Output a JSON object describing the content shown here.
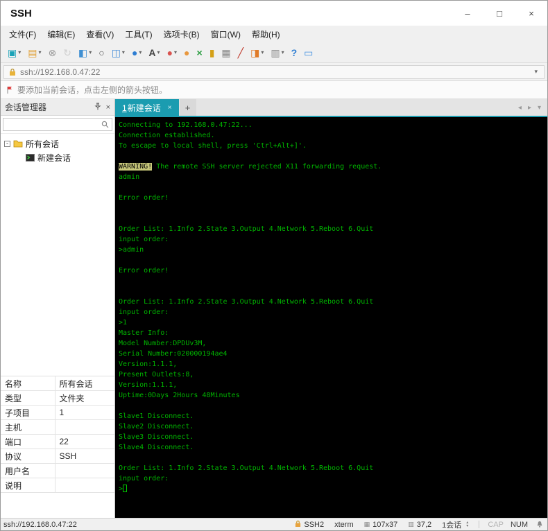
{
  "colors": {
    "accent": "#1b9cb0",
    "terminal_background": "#000000",
    "terminal_foreground": "#00b400",
    "warning_highlight": "#c8c87a"
  },
  "window": {
    "title": "SSH",
    "controls": [
      {
        "name": "minimize-button",
        "glyph": "–"
      },
      {
        "name": "maximize-button",
        "glyph": "□"
      },
      {
        "name": "close-button",
        "glyph": "×"
      }
    ]
  },
  "menu_bar": {
    "items": [
      "文件(F)",
      "编辑(E)",
      "查看(V)",
      "工具(T)",
      "选项卡(B)",
      "窗口(W)",
      "帮助(H)"
    ]
  },
  "toolbar": {
    "icons": [
      {
        "name": "new-session-icon",
        "glyph": "▣",
        "color": "#19a3b8",
        "dropdown": true
      },
      {
        "name": "open-session-icon",
        "glyph": "▤",
        "color": "#e2a33d",
        "dropdown": true
      },
      {
        "name": "disconnect-icon",
        "glyph": "⊗",
        "color": "#999999",
        "dropdown": false
      },
      {
        "name": "reconnect-icon",
        "glyph": "↻",
        "color": "#b5b5b5",
        "dropdown": false,
        "disabled": true
      },
      {
        "name": "session-manager-icon",
        "glyph": "◧",
        "color": "#3f8fd2",
        "dropdown": true
      },
      {
        "name": "find-icon",
        "glyph": "○",
        "color": "#555555",
        "dropdown": false
      },
      {
        "name": "duplicate-session-icon",
        "glyph": "◫",
        "color": "#4a90d9",
        "dropdown": true
      },
      {
        "name": "web-browser-icon",
        "glyph": "●",
        "color": "#2d7dd2",
        "dropdown": true
      },
      {
        "name": "font-icon",
        "glyph": "A",
        "color": "#444444",
        "dropdown": true,
        "bold": true
      },
      {
        "name": "logging-icon",
        "glyph": "●",
        "color": "#d9534f",
        "dropdown": true
      },
      {
        "name": "capture-icon",
        "glyph": "●",
        "color": "#e8973d",
        "dropdown": false
      },
      {
        "name": "fullscreen-icon",
        "glyph": "×",
        "color": "#2e9e43",
        "dropdown": false,
        "bold": true
      },
      {
        "name": "lock-screen-icon",
        "glyph": "▮",
        "color": "#d4a017",
        "dropdown": false
      },
      {
        "name": "print-icon",
        "glyph": "▦",
        "color": "#888888",
        "dropdown": false
      },
      {
        "name": "highlight-pen-icon",
        "glyph": "╱",
        "color": "#c0392b",
        "dropdown": false,
        "bold": true
      },
      {
        "name": "transfer-icon",
        "glyph": "◨",
        "color": "#e07b28",
        "dropdown": true
      },
      {
        "name": "layout-icon",
        "glyph": "▥",
        "color": "#888888",
        "dropdown": true
      },
      {
        "name": "help-icon",
        "glyph": "?",
        "color": "#2d7dd2",
        "dropdown": false,
        "bold": true
      },
      {
        "name": "feedback-icon",
        "glyph": "▭",
        "color": "#3b8de0",
        "dropdown": false
      }
    ]
  },
  "address_bar": {
    "url": "ssh://192.168.0.47:22",
    "dropdown_glyph": "▾"
  },
  "notice_bar": {
    "text": "要添加当前会话，点击左侧的箭头按钮。"
  },
  "session_manager": {
    "title": "会话管理器",
    "close_glyph": "×",
    "tree": [
      {
        "label": "所有会话",
        "icon": "folder",
        "level": 0,
        "expandable": true,
        "id": "all-sessions"
      },
      {
        "label": "新建会话",
        "icon": "session",
        "level": 1,
        "expandable": false,
        "id": "new-session"
      }
    ],
    "properties": [
      {
        "label": "名称",
        "value": "所有会话"
      },
      {
        "label": "类型",
        "value": "文件夹"
      },
      {
        "label": "子项目",
        "value": "1"
      },
      {
        "label": "主机",
        "value": ""
      },
      {
        "label": "端口",
        "value": "22"
      },
      {
        "label": "协议",
        "value": "SSH"
      },
      {
        "label": "用户名",
        "value": ""
      },
      {
        "label": "说明",
        "value": ""
      }
    ]
  },
  "tabs": {
    "active_tab": {
      "number": "1",
      "title": "新建会话"
    },
    "close_glyph": "×",
    "new_tab_glyph": "+",
    "nav": {
      "prev": "◂",
      "next": "▸",
      "menu": "▾"
    }
  },
  "terminal": {
    "lines": [
      "Connecting to 192.168.0.47:22...",
      "Connection established.",
      "To escape to local shell, press 'Ctrl+Alt+]'.",
      "",
      {
        "segments": [
          {
            "text": "WARNING!",
            "inverse": true
          },
          {
            "text": " The remote SSH server rejected X11 forwarding request."
          }
        ]
      },
      "admin",
      "",
      "Error order!",
      "",
      "",
      "Order List: 1.Info 2.State 3.Output 4.Network 5.Reboot 6.Quit",
      "input order:",
      ">admin",
      "",
      "Error order!",
      "",
      "",
      "Order List: 1.Info 2.State 3.Output 4.Network 5.Reboot 6.Quit",
      "input order:",
      ">1",
      "Master Info:",
      "Model Number:DPDUv3M,",
      "Serial Number:020000194ae4",
      "Version:1.1.1,",
      "Present Outlets:8,",
      "Version:1.1.1,",
      "Uptime:0Days 2Hours 48Minutes",
      "",
      "Slave1 Disconnect.",
      "Slave2 Disconnect.",
      "Slave3 Disconnect.",
      "Slave4 Disconnect.",
      "",
      "Order List: 1.Info 2.State 3.Output 4.Network 5.Reboot 6.Quit",
      "input order:",
      {
        "segments": [
          {
            "text": ">"
          }
        ],
        "cursor": true
      }
    ]
  },
  "status_bar": {
    "session_url": "ssh://192.168.0.47:22",
    "protocol": "SSH2",
    "terminal_type": "xterm",
    "terminal_size": "107x37",
    "size_icon_glyph": "▦",
    "cursor_position": "37,2",
    "cursor_icon_glyph": "▥",
    "session_count": "1会话",
    "nav_up_glyph": "▴",
    "nav_down_glyph": "▾",
    "cap_indicator": "CAP",
    "num_indicator": "NUM"
  }
}
